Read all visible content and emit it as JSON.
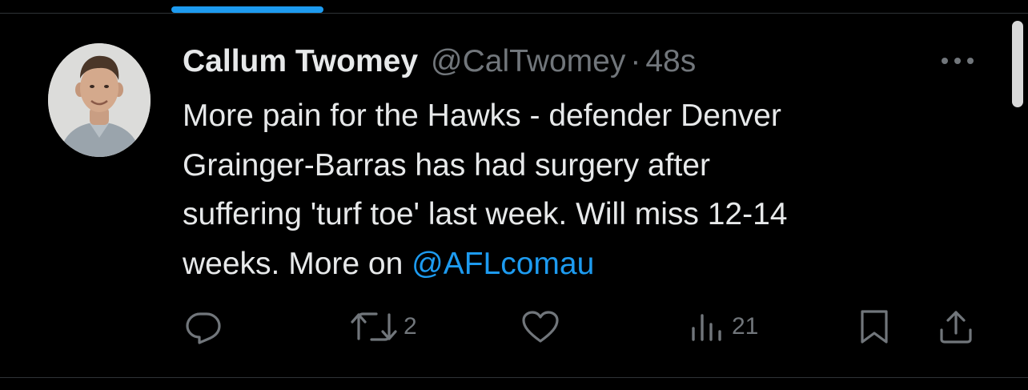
{
  "tweet": {
    "author": {
      "display_name": "Callum Twomey",
      "handle": "@CalTwomey",
      "avatar_icon": "profile-photo"
    },
    "separator": "·",
    "timestamp": "48s",
    "more_icon": "ellipsis-icon",
    "text_lines": [
      "More pain for the Hawks - defender Denver",
      "Grainger-Barras has had surgery after",
      "suffering 'turf toe' last week. Will miss 12-14"
    ],
    "last_line_prefix": "weeks. More on ",
    "mention": "@AFLcomau",
    "actions": {
      "reply": {
        "icon": "reply-icon",
        "count": ""
      },
      "retweet": {
        "icon": "retweet-icon",
        "count": "2"
      },
      "like": {
        "icon": "heart-icon",
        "count": ""
      },
      "views": {
        "icon": "views-icon",
        "count": "21"
      },
      "bookmark": {
        "icon": "bookmark-icon"
      },
      "share": {
        "icon": "share-icon"
      }
    }
  },
  "colors": {
    "background": "#000000",
    "primary_text": "#e7e9ea",
    "secondary_text": "#71767b",
    "accent": "#1d9bf0",
    "divider": "#2f3336"
  }
}
